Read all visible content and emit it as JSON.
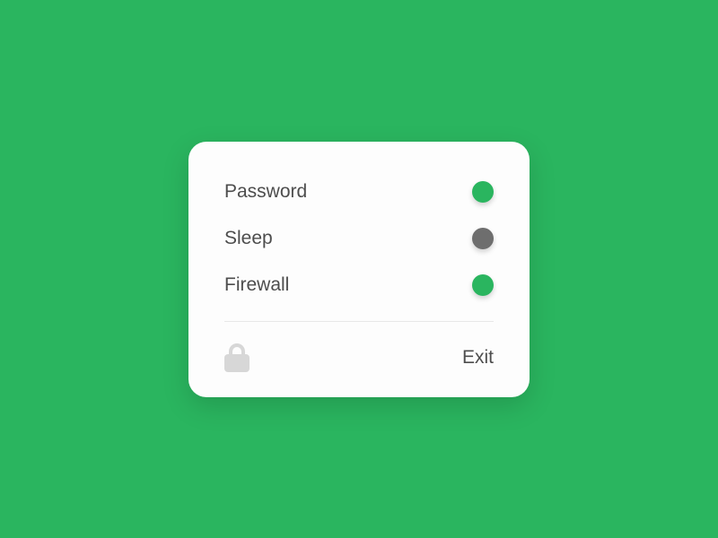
{
  "settings": {
    "items": [
      {
        "label": "Password",
        "state": "on"
      },
      {
        "label": "Sleep",
        "state": "off"
      },
      {
        "label": "Firewall",
        "state": "on"
      }
    ]
  },
  "footer": {
    "exit_label": "Exit"
  },
  "colors": {
    "accent": "#2ab55f",
    "off": "#6e6e6e",
    "background": "#2ab55f"
  }
}
